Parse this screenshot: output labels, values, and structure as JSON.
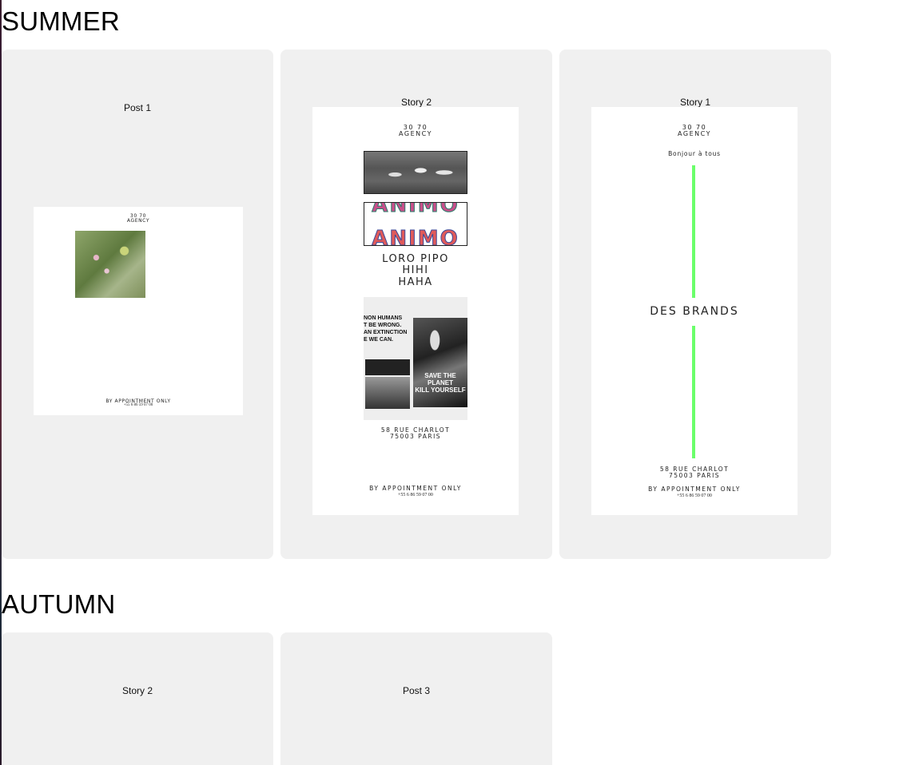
{
  "sections": [
    {
      "title": "SUMMER",
      "cards": [
        {
          "label": "Post 1",
          "agency": [
            "30 70",
            "AGENCY"
          ],
          "footer": [
            "BY APPOINTMENT ONLY",
            "+55 6 86 59 07 00"
          ]
        },
        {
          "label": "Story 2",
          "agency": [
            "30 70",
            "AGENCY"
          ],
          "headline": [
            "LORO PIPO",
            "HIHI",
            "HAHA"
          ],
          "animo_text": "ANIMO",
          "collage_text": [
            "NON HUMANS",
            "T BE WRONG.",
            "AN EXTINCTION",
            "E WE CAN.",
            "SAVE THE PLANET",
            "KILL YOURSELF"
          ],
          "address": [
            "58 RUE CHARLOT",
            "75003 PARIS"
          ],
          "footer": [
            "BY APPOINTMENT ONLY",
            "+55 6 86 59 07 00"
          ]
        },
        {
          "label": "Story 1",
          "agency": [
            "30 70",
            "AGENCY"
          ],
          "greeting": "Bonjour à tous",
          "headline": "DES BRANDS",
          "address": [
            "58 RUE CHARLOT",
            "75003 PARIS"
          ],
          "footer": [
            "BY APPOINTMENT ONLY",
            "+55 6 86 59 07 00"
          ],
          "accent_color": "#6bff6b"
        }
      ]
    },
    {
      "title": "AUTUMN",
      "cards": [
        {
          "label": "Story 2"
        },
        {
          "label": "Post 3"
        }
      ]
    }
  ]
}
